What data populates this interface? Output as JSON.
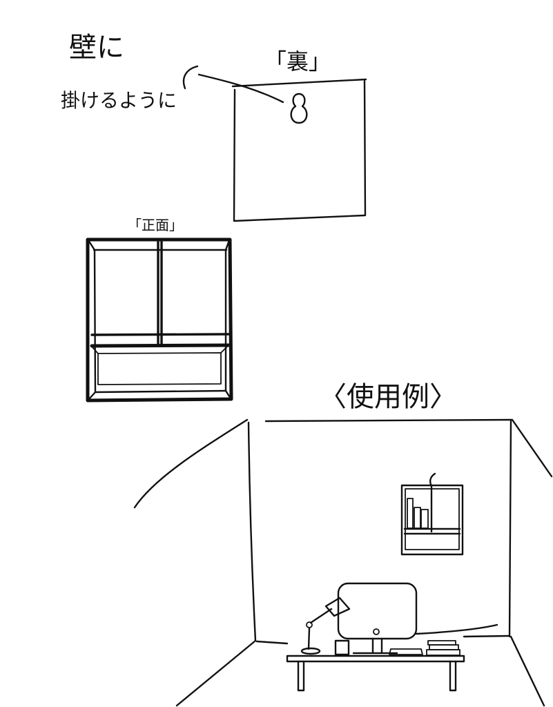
{
  "colors": {
    "background": "#ffffff",
    "ink": "#111111"
  },
  "annotations": {
    "wall_note_line1": "壁に",
    "wall_note_line2": "掛けるように",
    "back_label": "「裏」",
    "front_label": "「正面」",
    "usage_label": "〈使用例〉"
  },
  "icons": {
    "keyhole": "keyhole-icon",
    "hook": "hook-icon"
  }
}
